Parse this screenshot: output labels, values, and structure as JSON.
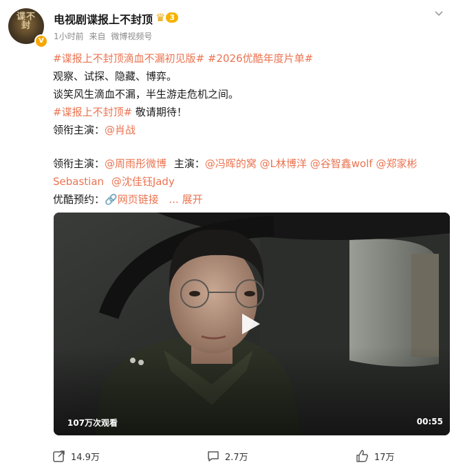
{
  "account": {
    "avatar_seal": "谍不封",
    "name": "电视剧谍报上不封顶",
    "vip_level": "3",
    "time": "1小时前",
    "source_prefix": "来自",
    "source": "微博视频号"
  },
  "post": {
    "line1_tag1": "#谍报上不封顶滴血不漏初见版#",
    "line1_tag2": "#2026优酷年度片单#",
    "line2": "观察、试探、隐藏、博弈。",
    "line3": "谈笑风生滴血不漏，半生游走危机之间。",
    "line4_tag": "#谍报上不封顶#",
    "line4_text": "敬请期待！",
    "line5_label": "领衔主演：",
    "line5_mention": "@肖战",
    "line6_label": "领衔主演：",
    "line6_mention": "@周雨彤微博",
    "line6_label2": "主演：",
    "line6_m1": "@冯晖的窝",
    "line6_m2": "@L林博洋",
    "line6_m3": "@谷智鑫wolf",
    "line6_m4": "@郑家彬",
    "line7_m1": "Sebastian",
    "line7_m2": "@沈佳钰Jady",
    "line8_label": "优酷预约：",
    "line8_link": "网页链接",
    "line8_more": "... 展开"
  },
  "video": {
    "views": "107万次观看",
    "duration": "00:55"
  },
  "footer": {
    "share": "14.9万",
    "comment": "2.7万",
    "like": "17万"
  },
  "colors": {
    "link": "#eb7350",
    "vip": "#f5b300"
  }
}
